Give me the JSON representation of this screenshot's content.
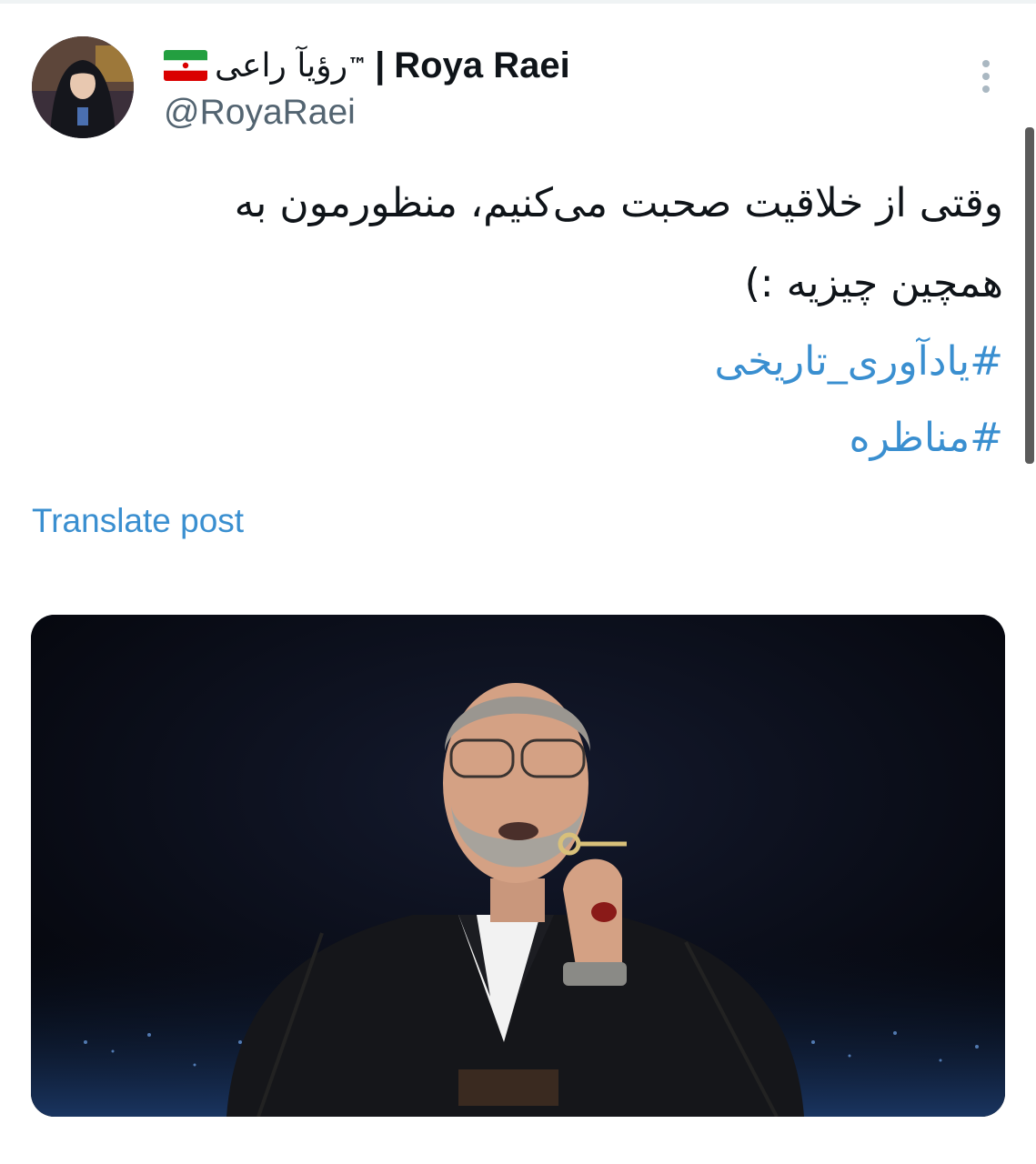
{
  "author": {
    "display_name_fa": "رؤیآ راعی",
    "trademark": "™",
    "separator": "|",
    "display_name_en": "Roya Raei",
    "flag_icon": "iran-flag-icon",
    "handle": "@RoyaRaei"
  },
  "tweet": {
    "text": "وقتی از خلاقیت صحبت می‌کنیم، منظورمون به همچین چیزیه :)",
    "hashtags": [
      "#یادآوری_تاریخی",
      "#مناظره"
    ]
  },
  "actions": {
    "translate_label": "Translate post",
    "more_icon": "more-vertical-icon"
  },
  "colors": {
    "link": "#3a8fd0",
    "text": "#0f1419",
    "secondary": "#536471"
  }
}
